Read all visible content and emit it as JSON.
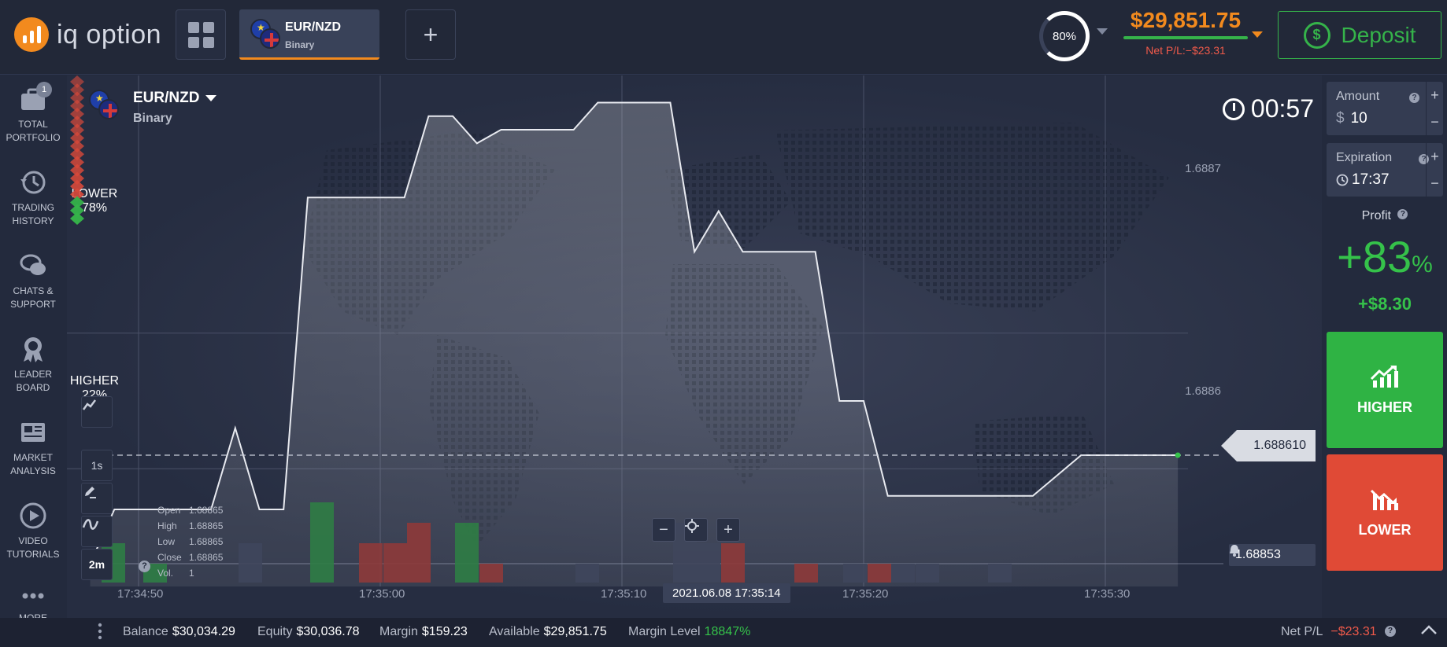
{
  "topbar": {
    "logo_text": "iq option",
    "asset_tab": {
      "name": "EUR/NZD",
      "type": "Binary"
    },
    "risk_percent": "80%",
    "balance": "$29,851.75",
    "net_pl": "Net P/L:−$23.31",
    "deposit_label": "Deposit"
  },
  "sidebar": {
    "portfolio_badge": "1",
    "items": [
      {
        "label": "TOTAL PORTFOLIO",
        "icon": "briefcase-icon"
      },
      {
        "label": "TRADING HISTORY",
        "icon": "history-icon"
      },
      {
        "label": "CHATS & SUPPORT",
        "icon": "chat-icon"
      },
      {
        "label": "LEADER BOARD",
        "icon": "medal-icon"
      },
      {
        "label": "MARKET ANALYSIS",
        "icon": "newspaper-icon"
      },
      {
        "label": "VIDEO TUTORIALS",
        "icon": "play-icon"
      },
      {
        "label": "MORE",
        "icon": "more-icon"
      }
    ]
  },
  "chart": {
    "asset_name": "EUR/NZD",
    "asset_type": "Binary",
    "timer": "00:57",
    "lower_label": "LOWER",
    "lower_pct": "78%",
    "higher_label": "HIGHER",
    "higher_pct": "22%",
    "tools": {
      "interval": "1s",
      "timeframe": "2m"
    },
    "ohlc": {
      "open_label": "Open",
      "open": "1.68865",
      "high_label": "High",
      "high": "1.68865",
      "low_label": "Low",
      "low": "1.68865",
      "close_label": "Close",
      "close": "1.68865",
      "vol_label": "Vol.",
      "vol": "1"
    },
    "current_price": "1.688610",
    "alert_price": "1.68853",
    "price_levels": [
      "1.6887",
      "1.6886"
    ],
    "time_labels": [
      "17:34:50",
      "17:35:00",
      "17:35:10",
      "17:35:20",
      "17:35:30"
    ],
    "now_label": "2021.06.08 17:35:14"
  },
  "chart_data": {
    "type": "line",
    "title": "",
    "xlabel": "",
    "ylabel": "",
    "x": [
      "17:34:48",
      "17:34:49",
      "17:34:51",
      "17:34:53",
      "17:34:54",
      "17:34:55",
      "17:34:56",
      "17:34:57",
      "17:34:58",
      "17:34:59",
      "17:35:00",
      "17:35:01",
      "17:35:02",
      "17:35:03",
      "17:35:04",
      "17:35:05",
      "17:35:06",
      "17:35:07",
      "17:35:08",
      "17:35:09",
      "17:35:11",
      "17:35:12",
      "17:35:13",
      "17:35:14",
      "17:35:15",
      "17:35:17",
      "17:35:18",
      "17:35:19",
      "17:35:20",
      "17:35:21",
      "17:35:22",
      "17:35:24",
      "17:35:25",
      "17:35:27",
      "17:35:29",
      "17:35:31",
      "17:35:33"
    ],
    "y": [
      1.68853,
      1.68857,
      1.68857,
      1.68857,
      1.68863,
      1.68857,
      1.68857,
      1.6888,
      1.6888,
      1.6888,
      1.6888,
      1.6888,
      1.68886,
      1.68886,
      1.68884,
      1.68885,
      1.68885,
      1.68885,
      1.68885,
      1.68887,
      1.68887,
      1.68887,
      1.68876,
      1.68879,
      1.68876,
      1.68876,
      1.68876,
      1.68865,
      1.68865,
      1.68858,
      1.68858,
      1.68858,
      1.68858,
      1.68858,
      1.68861,
      1.68861,
      1.68861
    ],
    "volume_colors": [
      "green",
      "green",
      "gray",
      "green",
      "red",
      "red",
      "red",
      "green",
      "red",
      "gray",
      "gray",
      "gray",
      "red",
      "red",
      "gray",
      "red",
      "gray",
      "gray",
      "gray",
      "gray",
      "gray",
      "gray"
    ],
    "ylim": [
      1.68849,
      1.68889
    ],
    "grid": true
  },
  "rpanel": {
    "amount_label": "Amount",
    "amount_currency": "$",
    "amount_value": "10",
    "expiration_label": "Expiration",
    "expiration_value": "17:37",
    "profit_label": "Profit",
    "profit_pct": "+83",
    "profit_pct_sign": "%",
    "profit_amount": "+$8.30",
    "higher_label": "HIGHER",
    "lower_label": "LOWER"
  },
  "bottombar": {
    "balance_label": "Balance",
    "balance": "$30,034.29",
    "equity_label": "Equity",
    "equity": "$30,036.78",
    "margin_label": "Margin",
    "margin": "$159.23",
    "available_label": "Available",
    "available": "$29,851.75",
    "margin_level_label": "Margin Level",
    "margin_level": "18847%",
    "net_pl_label": "Net P/L",
    "net_pl": "−$23.31"
  },
  "colors": {
    "accent": "#f28a1e",
    "green": "#35b34a",
    "red": "#e04a36",
    "bg": "#232a3d"
  }
}
